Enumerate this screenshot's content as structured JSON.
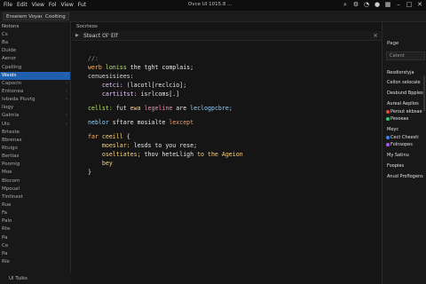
{
  "menu": [
    "File",
    "Edit",
    "View",
    "Fol",
    "View",
    "Fut"
  ],
  "window_title": "Ovce UI 1015.8 ...",
  "window_controls": [
    "search-icon",
    "settings-icon",
    "bell-icon",
    "account-icon",
    "grid-icon",
    "minimize-icon",
    "maximize-icon",
    "close-icon"
  ],
  "toolbar": {
    "tabs": [
      "Enseiem Voyae!",
      "Coolting"
    ]
  },
  "sidebar": {
    "title": "Notons",
    "items": [
      {
        "label": "Cs",
        "active": false
      },
      {
        "label": "Ba",
        "active": false
      },
      {
        "label": "Dulde",
        "active": false
      },
      {
        "label": "Aenor",
        "active": false
      },
      {
        "label": "Cpelling",
        "active": false
      },
      {
        "label": "Waids",
        "active": true
      },
      {
        "label": "Capocin",
        "active": false
      },
      {
        "label": "Entionea",
        "active": false
      },
      {
        "label": "Ivbeda Piuvtg",
        "active": false
      },
      {
        "label": "llogy",
        "active": false
      },
      {
        "label": "Galmla",
        "active": false
      },
      {
        "label": "Ulo",
        "active": false
      },
      {
        "label": "Brteste",
        "active": false
      },
      {
        "label": "Bbrenas",
        "active": false
      },
      {
        "label": "Rtuigo",
        "active": false
      },
      {
        "label": "Bertias",
        "active": false
      },
      {
        "label": "Poomig",
        "active": false
      },
      {
        "label": "Moe",
        "active": false
      },
      {
        "label": "Blocom",
        "active": false
      },
      {
        "label": "Mpoual",
        "active": false
      },
      {
        "label": "Tintinest",
        "active": false
      },
      {
        "label": "Rue",
        "active": false
      },
      {
        "label": "Fa",
        "active": false
      },
      {
        "label": "Palo",
        "active": false
      },
      {
        "label": "Rte",
        "active": false
      },
      {
        "label": "Pa",
        "active": false
      },
      {
        "label": "Ce",
        "active": false
      },
      {
        "label": "Pa",
        "active": false
      },
      {
        "label": "Rle",
        "active": false
      }
    ]
  },
  "editor": {
    "header": "Socrteos",
    "tab_name": "Steact Ol' Elf",
    "lines": [
      [
        {
          "t": "//:",
          "c": "#8a8a8a"
        }
      ],
      [
        {
          "t": "werb ",
          "c": "#ffb05c"
        },
        {
          "t": "loniss",
          "c": "#b6e36a"
        },
        {
          "t": " the tght complais;",
          "c": "#e8e8e8"
        }
      ],
      [
        {
          "t": "cenuesisiees:",
          "c": "#d9d9d9"
        }
      ],
      [
        {
          "t": "    cetci: ",
          "c": "#e7c9ff"
        },
        {
          "t": "(lacotl[reclcio];",
          "c": "#e6e6e6"
        }
      ],
      [
        {
          "t": "    cartiitst: ",
          "c": "#e7c9ff"
        },
        {
          "t": "isrlcoms[.]",
          "c": "#e6e6e6"
        }
      ],
      [
        {
          "t": "",
          "c": "#e6e6e6"
        }
      ],
      [
        {
          "t": "cellst: ",
          "c": "#b6e36a"
        },
        {
          "t": "fut ",
          "c": "#e6e6e6"
        },
        {
          "t": "ewa ",
          "c": "#ffd37a"
        },
        {
          "t": "legeline ",
          "c": "#ff8aa8"
        },
        {
          "t": "are ",
          "c": "#e6e6e6"
        },
        {
          "t": "leclogpcbre;",
          "c": "#8fd4ff"
        }
      ],
      [
        {
          "t": "",
          "c": "#e6e6e6"
        }
      ],
      [
        {
          "t": "neblor ",
          "c": "#8fd4ff"
        },
        {
          "t": "sftare ",
          "c": "#e6e6e6"
        },
        {
          "t": "mosialte ",
          "c": "#e6e6e6"
        },
        {
          "t": "lexcept",
          "c": "#ff9a5c"
        }
      ],
      [
        {
          "t": "",
          "c": "#e6e6e6"
        }
      ],
      [
        {
          "t": "far ",
          "c": "#ffb05c"
        },
        {
          "t": "ceeill ",
          "c": "#ffd37a"
        },
        {
          "t": "{",
          "c": "#e6e6e6"
        }
      ],
      [
        {
          "t": "    moeslar: ",
          "c": "#ffd37a"
        },
        {
          "t": "lesds to you rese;",
          "c": "#e6e6e6"
        }
      ],
      [
        {
          "t": "    oseltiates; ",
          "c": "#ffd37a"
        },
        {
          "t": "thov heteLligh ",
          "c": "#e6e6e6"
        },
        {
          "t": "to the Ageion",
          "c": "#ffd37a"
        }
      ],
      [
        {
          "t": "    bey",
          "c": "#ffd37a"
        }
      ],
      [
        {
          "t": "}",
          "c": "#e6e6e6"
        }
      ]
    ]
  },
  "rpanel": {
    "title": "Page",
    "search_placeholder": "Catent",
    "items": [
      {
        "label": "Resdiorstyja",
        "color": "#e0e0e0",
        "dot": "",
        "indent": false
      },
      {
        "label": "Cellon selocale",
        "color": "#e0e0e0",
        "dot": "",
        "indent": false
      },
      {
        "label": "Desbund Bpplest",
        "color": "#e0e0e0",
        "dot": "",
        "indent": false
      },
      {
        "label": "Aureal Aeplios",
        "color": "#e0e0e0",
        "dot": "",
        "indent": false
      },
      {
        "label": "Perout ekbsae",
        "color": "#e0e0e0",
        "dot": "#e9483f",
        "indent": true
      },
      {
        "label": "Pesoeas",
        "color": "#e0e0e0",
        "dot": "#2ecc71",
        "indent": true
      },
      {
        "label": "Meyc",
        "color": "#e0e0e0",
        "dot": "",
        "indent": false
      },
      {
        "label": "Cect Cheesti",
        "color": "#e0e0e0",
        "dot": "#3b82f6",
        "indent": true
      },
      {
        "label": "Folnsopes",
        "color": "#e0e0e0",
        "dot": "#a855f7",
        "indent": true
      },
      {
        "label": "My Satinu",
        "color": "#e0e0e0",
        "dot": "",
        "indent": false
      },
      {
        "label": "Foopies",
        "color": "#e0e0e0",
        "dot": "",
        "indent": false
      },
      {
        "label": "Anud Proflogens",
        "color": "#e0e0e0",
        "dot": "",
        "indent": false
      }
    ]
  },
  "status": {
    "label": "Ul Tuiks"
  }
}
